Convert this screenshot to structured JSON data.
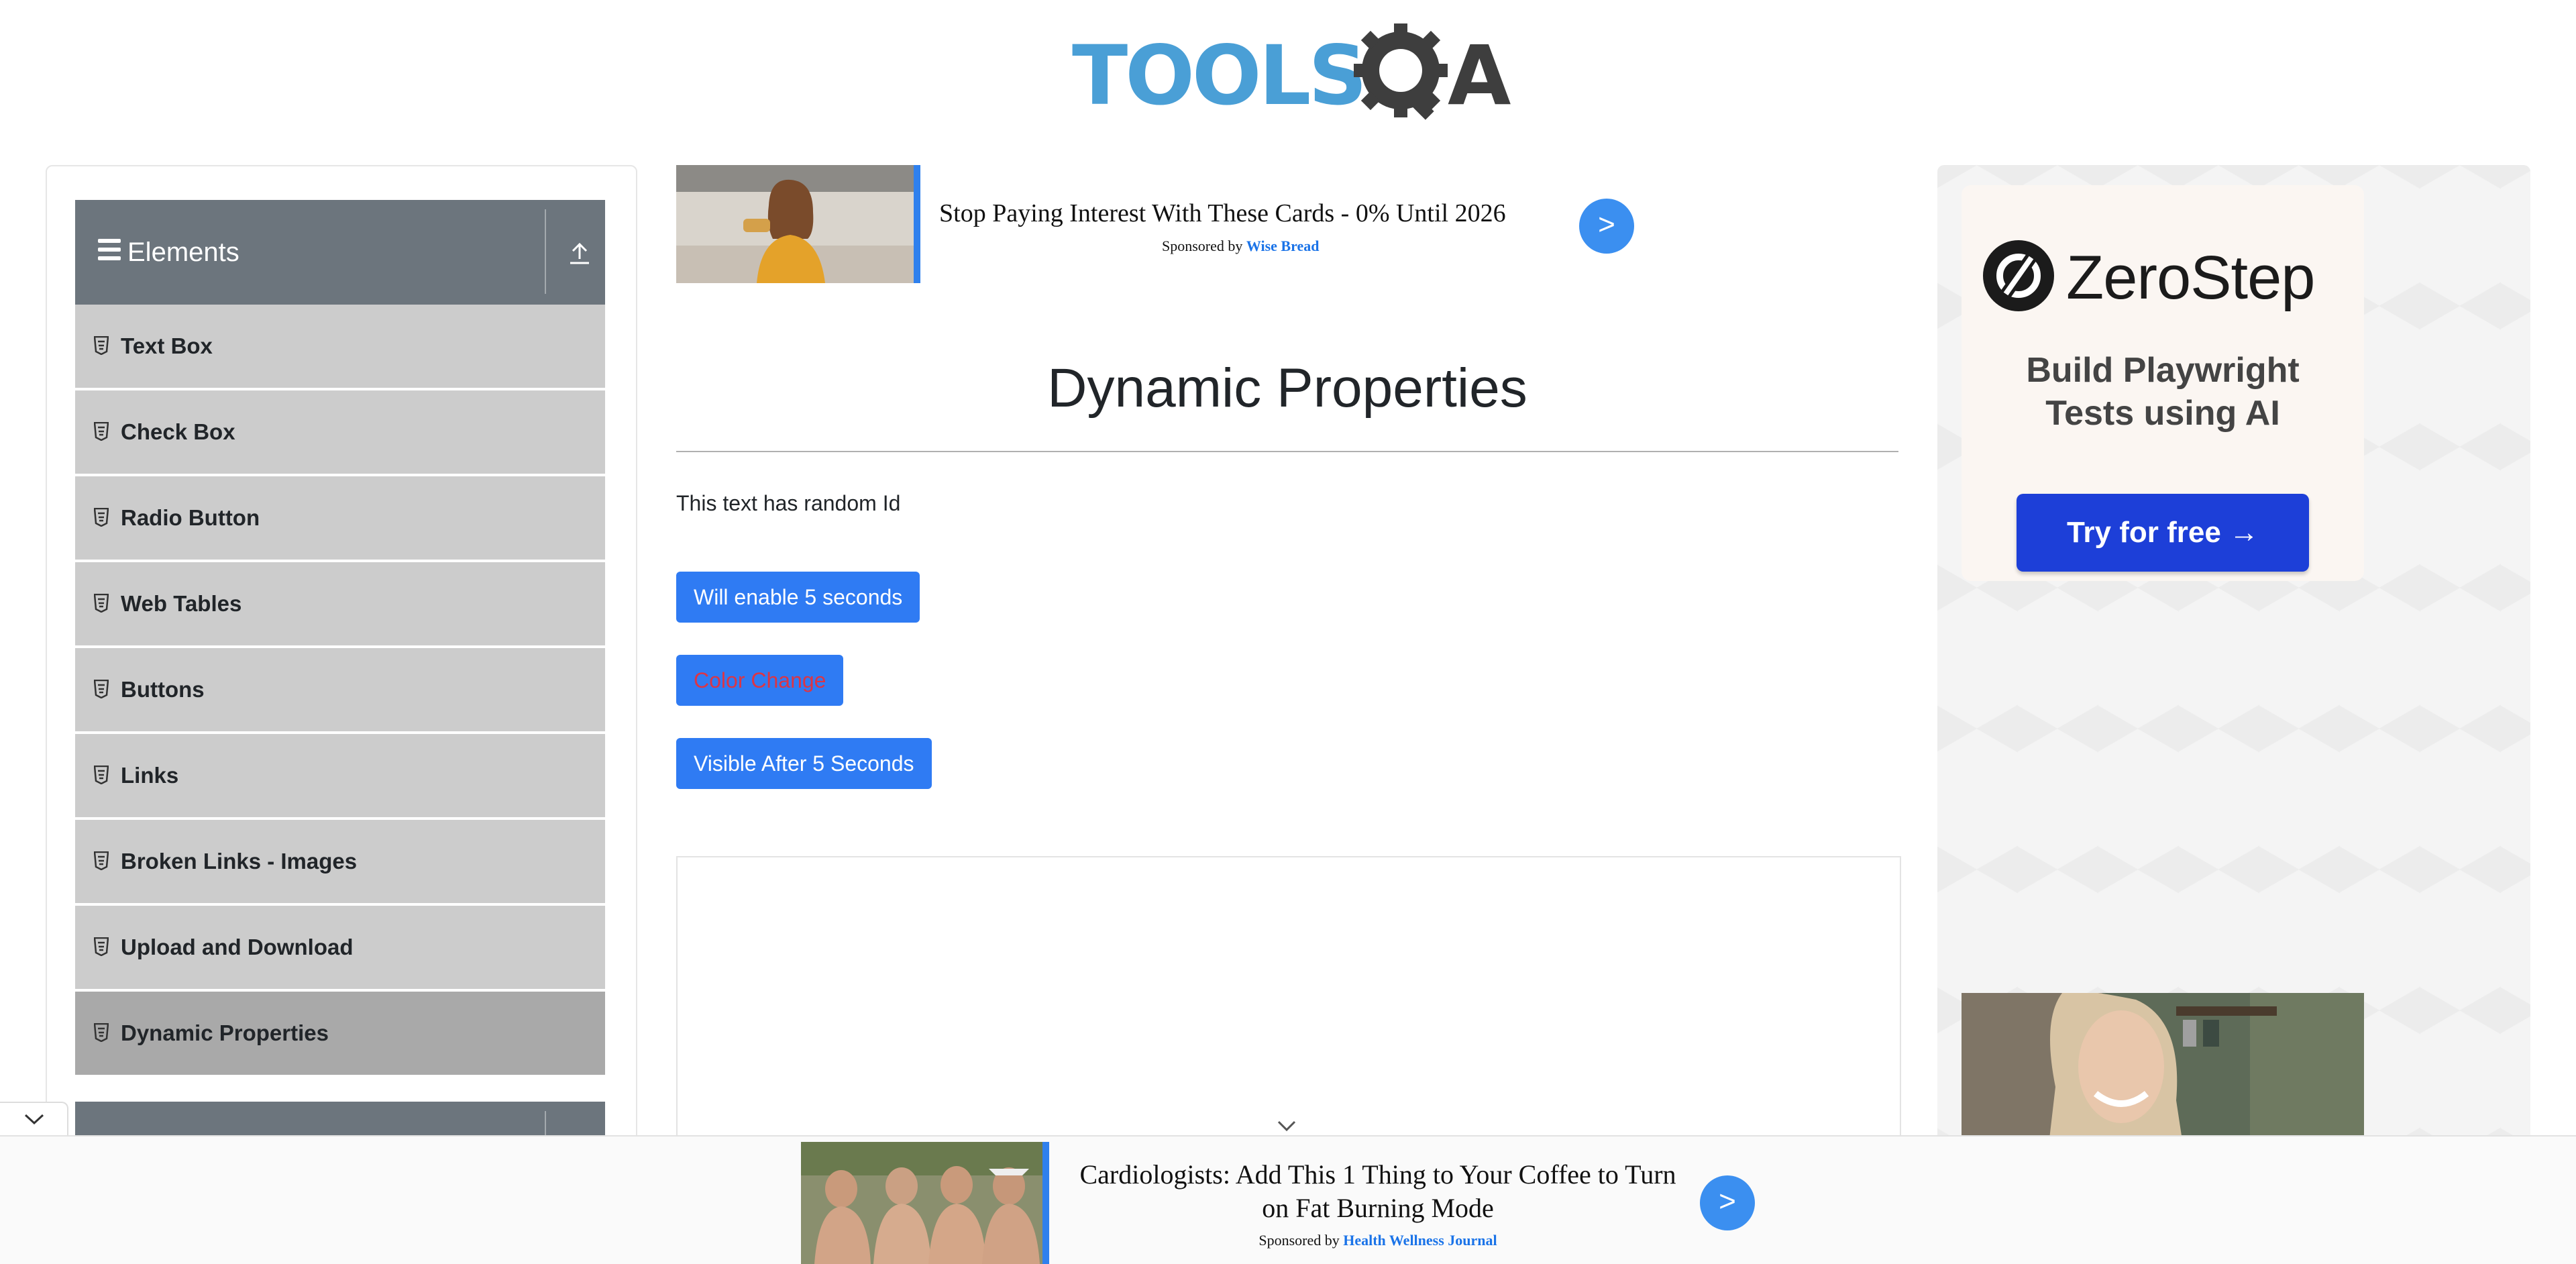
{
  "logo": {
    "alt": "TOOLSQA",
    "tools_text": "TOOLS",
    "a_text": "A"
  },
  "sidebar": {
    "group_title": "Elements",
    "items": [
      {
        "label": "Text Box"
      },
      {
        "label": "Check Box"
      },
      {
        "label": "Radio Button"
      },
      {
        "label": "Web Tables"
      },
      {
        "label": "Buttons"
      },
      {
        "label": "Links"
      },
      {
        "label": "Broken Links - Images"
      },
      {
        "label": "Upload and Download"
      },
      {
        "label": "Dynamic Properties",
        "active": true
      }
    ]
  },
  "ad_top": {
    "headline": "Stop Paying Interest With These Cards - 0% Until 2026",
    "sponsor_prefix": "Sponsored by",
    "sponsor_name": "Wise Bread",
    "cta": ">"
  },
  "main": {
    "title": "Dynamic Properties",
    "random_text": "This text has random Id",
    "buttons": {
      "enable_after": "Will enable 5 seconds",
      "color_change": "Color Change",
      "visible_after": "Visible After 5 Seconds"
    }
  },
  "ad_right": {
    "brand": "ZeroStep",
    "tagline_line1": "Build Playwright",
    "tagline_line2": "Tests using AI",
    "cta": "Try for free →"
  },
  "ad_bottom": {
    "headline": "Cardiologists: Add This 1 Thing to Your Coffee to Turn on Fat Burning Mode",
    "sponsor_prefix": "Sponsored by",
    "sponsor_name": "Health Wellness Journal",
    "cta": ">"
  },
  "colors": {
    "primary_button": "#2f7bf3",
    "color_change_text": "#dc3545",
    "sidebar_header": "#6c757d",
    "menu_item_bg": "#cccccc",
    "menu_item_active_bg": "#a9a9a9",
    "zerostep_cta": "#1d3fd8"
  }
}
